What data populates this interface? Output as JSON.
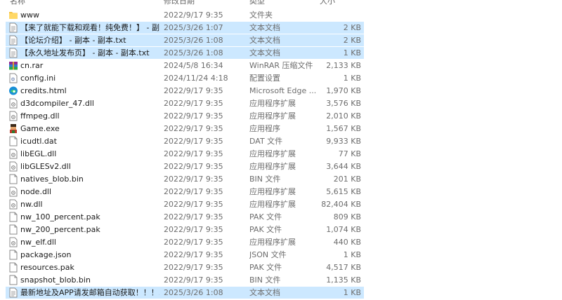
{
  "header": {
    "name": "名称",
    "date": "修改日期",
    "type": "类型",
    "size": "大小"
  },
  "files": [
    {
      "name": "www",
      "date": "2022/9/17 9:35",
      "type": "文件夹",
      "size": "",
      "icon": "folder-icon",
      "selected": false
    },
    {
      "name": "【来了就能下载和观看！纯免费！】 - 副...",
      "date": "2025/3/26 1:07",
      "type": "文本文档",
      "size": "2 KB",
      "icon": "text-file-icon",
      "selected": true
    },
    {
      "name": "【论坛介绍】 - 副本 - 副本.txt",
      "date": "2025/3/26 1:08",
      "type": "文本文档",
      "size": "2 KB",
      "icon": "text-file-icon",
      "selected": true
    },
    {
      "name": "【永久地址发布页】 - 副本 - 副本.txt",
      "date": "2025/3/26 1:08",
      "type": "文本文档",
      "size": "1 KB",
      "icon": "text-file-icon",
      "selected": true
    },
    {
      "name": "cn.rar",
      "date": "2024/5/8 16:34",
      "type": "WinRAR 压缩文件",
      "size": "2,133 KB",
      "icon": "winrar-archive-icon",
      "selected": false
    },
    {
      "name": "config.ini",
      "date": "2024/11/24 4:18",
      "type": "配置设置",
      "size": "1 KB",
      "icon": "settings-file-icon",
      "selected": false
    },
    {
      "name": "credits.html",
      "date": "2022/9/17 9:35",
      "type": "Microsoft Edge ...",
      "size": "1,970 KB",
      "icon": "edge-icon",
      "selected": false
    },
    {
      "name": "d3dcompiler_47.dll",
      "date": "2022/9/17 9:35",
      "type": "应用程序扩展",
      "size": "3,576 KB",
      "icon": "dll-file-icon",
      "selected": false
    },
    {
      "name": "ffmpeg.dll",
      "date": "2022/9/17 9:35",
      "type": "应用程序扩展",
      "size": "2,010 KB",
      "icon": "dll-file-icon",
      "selected": false
    },
    {
      "name": "Game.exe",
      "date": "2022/9/17 9:35",
      "type": "应用程序",
      "size": "1,567 KB",
      "icon": "game-exe-icon",
      "selected": false
    },
    {
      "name": "icudtl.dat",
      "date": "2022/9/17 9:35",
      "type": "DAT 文件",
      "size": "9,933 KB",
      "icon": "blank-file-icon",
      "selected": false
    },
    {
      "name": "libEGL.dll",
      "date": "2022/9/17 9:35",
      "type": "应用程序扩展",
      "size": "77 KB",
      "icon": "dll-file-icon",
      "selected": false
    },
    {
      "name": "libGLESv2.dll",
      "date": "2022/9/17 9:35",
      "type": "应用程序扩展",
      "size": "3,644 KB",
      "icon": "dll-file-icon",
      "selected": false
    },
    {
      "name": "natives_blob.bin",
      "date": "2022/9/17 9:35",
      "type": "BIN 文件",
      "size": "201 KB",
      "icon": "blank-file-icon",
      "selected": false
    },
    {
      "name": "node.dll",
      "date": "2022/9/17 9:35",
      "type": "应用程序扩展",
      "size": "5,615 KB",
      "icon": "dll-file-icon",
      "selected": false
    },
    {
      "name": "nw.dll",
      "date": "2022/9/17 9:35",
      "type": "应用程序扩展",
      "size": "82,404 KB",
      "icon": "dll-file-icon",
      "selected": false
    },
    {
      "name": "nw_100_percent.pak",
      "date": "2022/9/17 9:35",
      "type": "PAK 文件",
      "size": "809 KB",
      "icon": "blank-file-icon",
      "selected": false
    },
    {
      "name": "nw_200_percent.pak",
      "date": "2022/9/17 9:35",
      "type": "PAK 文件",
      "size": "1,074 KB",
      "icon": "blank-file-icon",
      "selected": false
    },
    {
      "name": "nw_elf.dll",
      "date": "2022/9/17 9:35",
      "type": "应用程序扩展",
      "size": "440 KB",
      "icon": "dll-file-icon",
      "selected": false
    },
    {
      "name": "package.json",
      "date": "2022/9/17 9:35",
      "type": "JSON 文件",
      "size": "1 KB",
      "icon": "blank-file-icon",
      "selected": false
    },
    {
      "name": "resources.pak",
      "date": "2022/9/17 9:35",
      "type": "PAK 文件",
      "size": "4,517 KB",
      "icon": "blank-file-icon",
      "selected": false
    },
    {
      "name": "snapshot_blob.bin",
      "date": "2022/9/17 9:35",
      "type": "BIN 文件",
      "size": "1,135 KB",
      "icon": "blank-file-icon",
      "selected": false
    },
    {
      "name": "最新地址及APP请发邮箱自动获取！！！...",
      "date": "2025/3/26 1:08",
      "type": "文本文档",
      "size": "1 KB",
      "icon": "text-file-icon",
      "selected": true
    }
  ],
  "colors": {
    "selection": "#cce8ff",
    "folder": "#f5c242",
    "edge": "#1a8fd8"
  }
}
